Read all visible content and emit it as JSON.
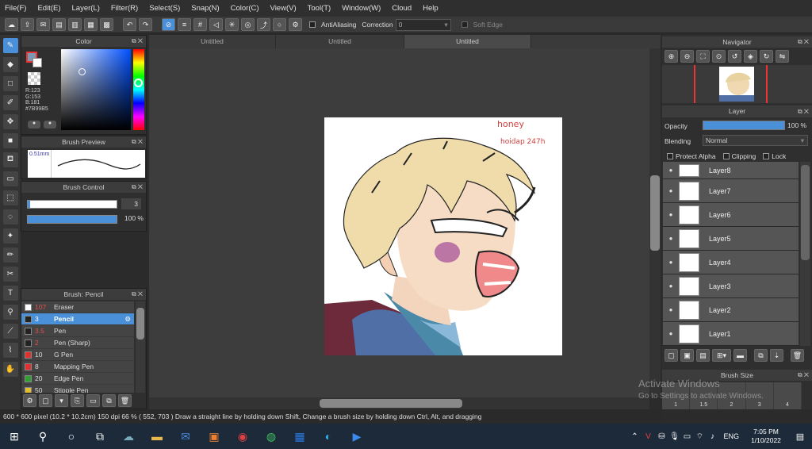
{
  "menu": {
    "items": [
      "File(F)",
      "Edit(E)",
      "Layer(L)",
      "Filter(R)",
      "Select(S)",
      "Snap(N)",
      "Color(C)",
      "View(V)",
      "Tool(T)",
      "Window(W)",
      "Cloud",
      "Help"
    ]
  },
  "toolbar": {
    "antialiasing": "AntiAliasing",
    "correction_label": "Correction",
    "correction_value": "0",
    "soft_edge": "Soft Edge"
  },
  "tabs": [
    "Untitled",
    "Untitled",
    "Untitled"
  ],
  "color_panel": {
    "title": "Color",
    "r": "R:123",
    "g": "G:153",
    "b": "B:181",
    "hex": "#7B99B5",
    "fg": "#7b99b5"
  },
  "brush_preview": {
    "title": "Brush Preview",
    "size": "0.51mm"
  },
  "brush_control": {
    "title": "Brush Control",
    "size_value": "3",
    "opacity_value": "100 %"
  },
  "brush_list": {
    "title": "Brush: Pencil",
    "items": [
      {
        "num": "107",
        "name": "Eraser",
        "color": "#ffffff",
        "num_color": "#e05050"
      },
      {
        "num": "3",
        "name": "Pencil",
        "color": "#222222",
        "num_color": "#ffffff",
        "selected": true
      },
      {
        "num": "3.5",
        "name": "Pen",
        "color": "#222222",
        "num_color": "#e05050"
      },
      {
        "num": "2",
        "name": "Pen (Sharp)",
        "color": "#222222",
        "num_color": "#e05050"
      },
      {
        "num": "10",
        "name": "G Pen",
        "color": "#e03030",
        "num_color": "#dddddd"
      },
      {
        "num": "8",
        "name": "Mapping Pen",
        "color": "#e03030",
        "num_color": "#dddddd"
      },
      {
        "num": "20",
        "name": "Edge Pen",
        "color": "#30a030",
        "num_color": "#dddddd"
      },
      {
        "num": "50",
        "name": "Stipple Pen",
        "color": "#e0c030",
        "num_color": "#dddddd"
      }
    ]
  },
  "artwork": {
    "text1": "honey",
    "text2": "hoidap 247h"
  },
  "navigator": {
    "title": "Navigator"
  },
  "layer_panel": {
    "title": "Layer",
    "opacity_label": "Opacity",
    "opacity_value": "100 %",
    "blending_label": "Blending",
    "blending_value": "Normal",
    "protect_alpha": "Protect Alpha",
    "clipping": "Clipping",
    "lock": "Lock",
    "layers": [
      "Layer8",
      "Layer7",
      "Layer6",
      "Layer5",
      "Layer4",
      "Layer3",
      "Layer2",
      "Layer1"
    ]
  },
  "brush_size": {
    "title": "Brush Size",
    "values": [
      "1",
      "1.5",
      "2",
      "3",
      "4"
    ]
  },
  "watermark": {
    "line1": "Activate Windows",
    "line2": "Go to Settings to activate Windows."
  },
  "status": {
    "text": "600 * 600 pixel  (10.2 * 10.2cm)  150 dpi  66 %  ( 552, 703 )  Draw a straight line by holding down Shift, Change a brush size by holding down Ctrl, Alt, and dragging"
  },
  "taskbar": {
    "time": "7:05 PM",
    "date": "1/10/2022",
    "lang": "ENG"
  },
  "colors": {
    "accent": "#4a90d9"
  }
}
